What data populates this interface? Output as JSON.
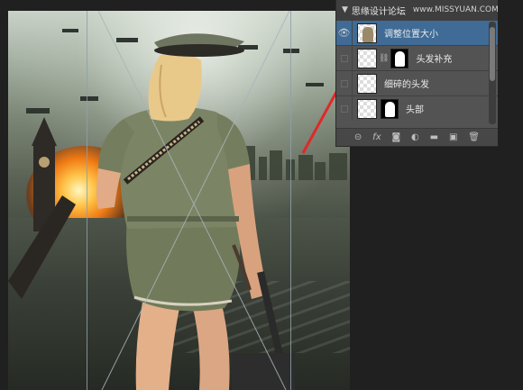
{
  "layers_panel": {
    "watermark_text": "思缘设计论坛",
    "watermark_url": "www.MISSYUAN.COM",
    "layers": [
      {
        "name": "调整位置大小",
        "visible": true,
        "selected": true
      },
      {
        "name": "头发补充",
        "visible": false,
        "selected": false
      },
      {
        "name": "细碎的头发",
        "visible": false,
        "selected": false
      },
      {
        "name": "头部",
        "visible": false,
        "selected": false
      }
    ],
    "footer_icons": [
      "link-icon",
      "fx-icon",
      "mask-icon",
      "adjustment-icon",
      "folder-icon",
      "new-layer-icon",
      "trash-icon"
    ]
  },
  "colors": {
    "selected_layer": "#3f6b96",
    "arrow": "#e0282a",
    "panel_bg": "#535353"
  }
}
